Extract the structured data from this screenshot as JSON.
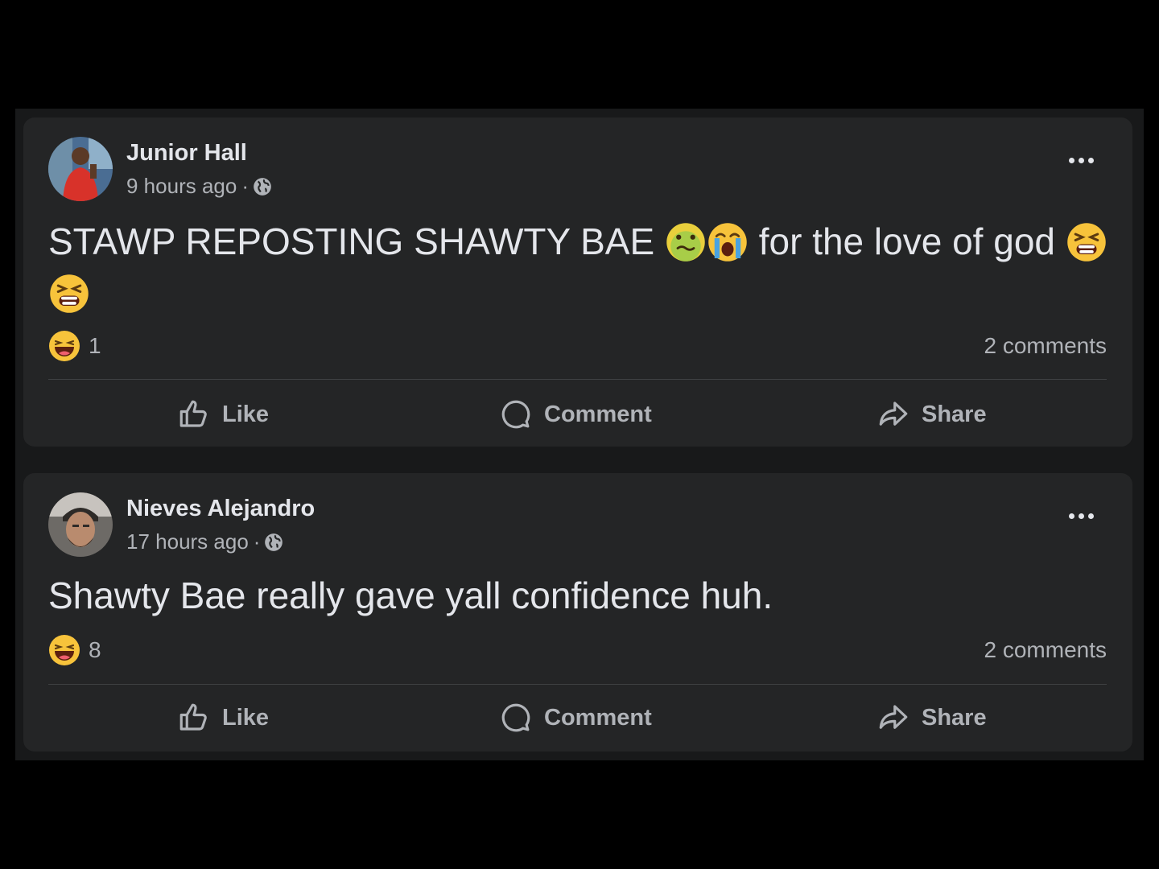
{
  "posts": [
    {
      "author": "Junior Hall",
      "time": "9 hours ago",
      "separator": "·",
      "text_part1": "STAWP REPOSTING SHAWTY BAE",
      "text_part2": "for the love of god",
      "reaction_count": "1",
      "comments": "2 comments"
    },
    {
      "author": "Nieves Alejandro",
      "time": "17 hours ago",
      "separator": "·",
      "text": "Shawty Bae really gave yall confidence huh.",
      "reaction_count": "8",
      "comments": "2 comments"
    }
  ],
  "actions": {
    "like": "Like",
    "comment": "Comment",
    "share": "Share"
  },
  "icons": {
    "avatar_1": "avatar-photo",
    "avatar_2": "avatar-photo",
    "privacy": "globe-icon",
    "menu": "more-options-icon",
    "reaction": "haha-reaction-icon",
    "emoji_nauseated": "nauseated-face-emoji",
    "emoji_crying": "loudly-crying-face-emoji",
    "emoji_tired": "tired-face-emoji"
  },
  "colors": {
    "page_bg": "#000000",
    "feed_bg": "#18191a",
    "card_bg": "#242526",
    "primary_text": "#e4e6eb",
    "secondary_text": "#b0b3b8",
    "divider": "#3e4042"
  }
}
